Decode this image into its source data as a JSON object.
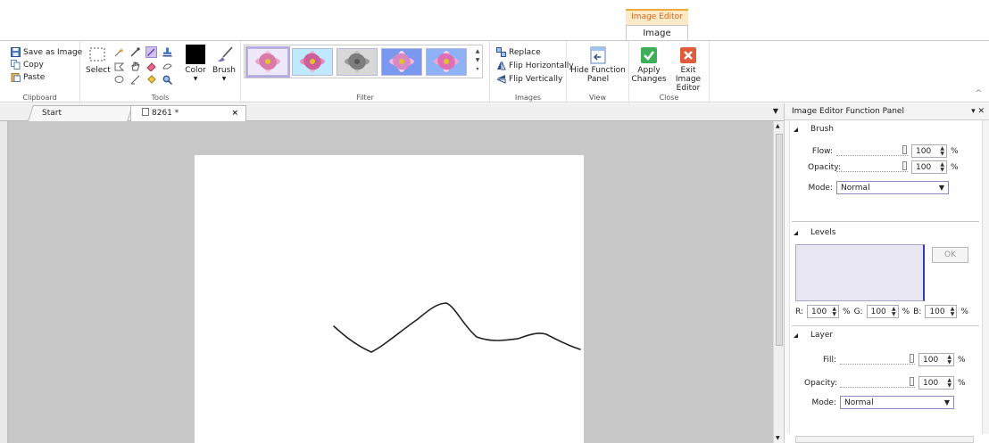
{
  "ribbon_tabs": {
    "context_header": "Image Editor",
    "active_tab": "Image"
  },
  "clipboard": {
    "save_as_image": "Save as Image",
    "copy": "Copy",
    "paste": "Paste",
    "label": "Clipboard"
  },
  "tools": {
    "select": "Select",
    "label": "Tools"
  },
  "color_brush": {
    "color": "Color",
    "brush": "Brush"
  },
  "filter": {
    "label": "Filter",
    "thumbnail_count": 5
  },
  "images": {
    "replace": "Replace",
    "flip_horizontally": "Flip Horizontally",
    "flip_vertically": "Flip Vertically",
    "label": "Images"
  },
  "view": {
    "hide_function_panel_line1": "Hide Function",
    "hide_function_panel_line2": "Panel",
    "label": "View"
  },
  "close": {
    "apply_line1": "Apply",
    "apply_line2": "Changes",
    "exit_line1": "Exit Image",
    "exit_line2": "Editor",
    "label": "Close"
  },
  "doc_tabs": {
    "start": "Start",
    "active": "8261 *",
    "close_glyph": "×"
  },
  "panel": {
    "title": "Image Editor Function Panel",
    "brush": {
      "heading": "Brush",
      "flow_label": "Flow:",
      "flow_value": "100",
      "opacity_label": "Opacity:",
      "opacity_value": "100",
      "percent": "%",
      "mode_label": "Mode:",
      "mode_value": "Normal"
    },
    "levels": {
      "heading": "Levels",
      "ok": "OK",
      "r_label": "R:",
      "r_value": "100",
      "g_label": "G:",
      "g_value": "100",
      "b_label": "B:",
      "b_value": "100",
      "percent": "%"
    },
    "layer": {
      "heading": "Layer",
      "fill_label": "Fill:",
      "fill_value": "100",
      "opacity_label": "Opacity:",
      "opacity_value": "100",
      "percent": "%",
      "mode_label": "Mode:",
      "mode_value": "Normal"
    }
  },
  "colors": {
    "ribbon_accent": "#f0a93b",
    "apply_green": "#3fae5a",
    "exit_red": "#e05a3c",
    "canvas_bg": "#c8c8c8"
  }
}
